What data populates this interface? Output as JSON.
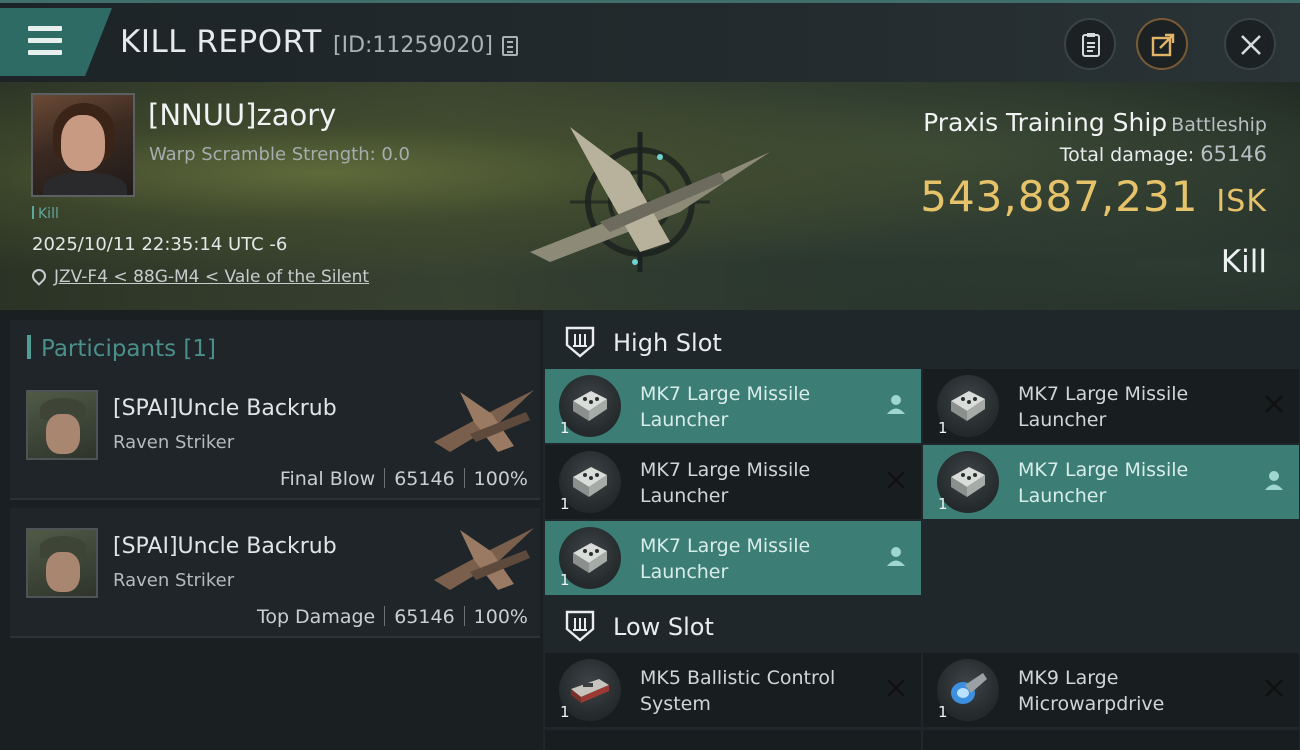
{
  "header": {
    "title": "KILL REPORT",
    "report_id": "[ID:11259020]",
    "buttons": {
      "clipboard": "clipboard-icon",
      "share": "share-icon",
      "close": "close-icon"
    }
  },
  "victim": {
    "name": "[NNUU]zaory",
    "warp_scramble": "Warp Scramble Strength: 0.0",
    "tag": "Kill",
    "timestamp": "2025/10/11 22:35:14 UTC -6",
    "location": "JZV-F4 < 88G-M4 < Vale of the Silent",
    "ship_name": "Praxis Training Ship",
    "ship_class": "Battleship",
    "total_damage_label": "Total damage:",
    "total_damage": "65146",
    "isk_value": "543,887,231",
    "isk_unit": "ISK",
    "result": "Kill"
  },
  "participants": {
    "header": "Participants [1]",
    "rows": [
      {
        "name": "[SPAI]Uncle Backrub",
        "ship": "Raven Striker",
        "role": "Final Blow",
        "damage": "65146",
        "percent": "100%"
      },
      {
        "name": "[SPAI]Uncle Backrub",
        "ship": "Raven Striker",
        "role": "Top Damage",
        "damage": "65146",
        "percent": "100%"
      }
    ]
  },
  "slots": {
    "high": {
      "label": "High Slot",
      "modules": [
        {
          "line1": "MK7 Large Missile",
          "line2": "Launcher",
          "qty": "1",
          "status": "person-icon",
          "state": "dropped"
        },
        {
          "line1": "MK7 Large Missile",
          "line2": "Launcher",
          "qty": "1",
          "status": "x-icon",
          "state": "destroyed"
        },
        {
          "line1": "MK7 Large Missile",
          "line2": "Launcher",
          "qty": "1",
          "status": "x-icon",
          "state": "destroyed"
        },
        {
          "line1": "MK7 Large Missile",
          "line2": "Launcher",
          "qty": "1",
          "status": "person-icon",
          "state": "dropped"
        },
        {
          "line1": "MK7 Large Missile",
          "line2": "Launcher",
          "qty": "1",
          "status": "person-icon",
          "state": "dropped"
        }
      ]
    },
    "low": {
      "label": "Low Slot",
      "modules": [
        {
          "line1": "MK5 Ballistic Control",
          "line2": "System",
          "qty": "1",
          "status": "x-icon",
          "state": "destroyed"
        },
        {
          "line1": "MK9 Large",
          "line2": "Microwarpdrive",
          "qty": "1",
          "status": "x-icon",
          "state": "destroyed"
        }
      ]
    }
  },
  "colors": {
    "accent_teal": "#3c7e76",
    "isk_gold": "#e6c36b"
  }
}
